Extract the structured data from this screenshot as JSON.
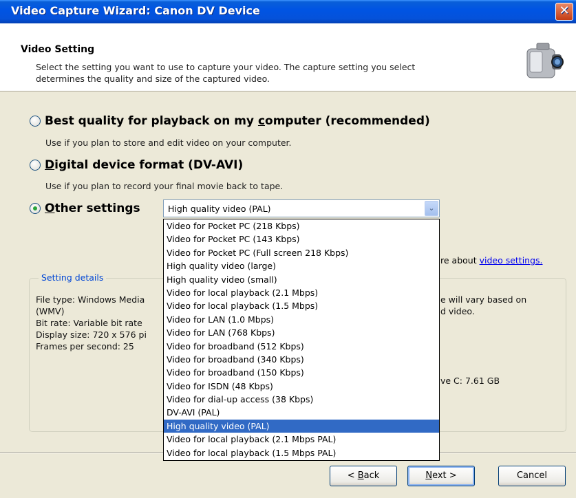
{
  "window": {
    "title": "Video Capture Wizard: Canon DV Device",
    "close_glyph": "✕"
  },
  "header": {
    "title": "Video Setting",
    "desc_line1": "Select the setting you want to use to capture your video. The capture setting you select",
    "desc_line2": "determines the quality and size of the captured video.",
    "icon": "camcorder-icon"
  },
  "options": [
    {
      "pre": "Best quality for playback on my ",
      "ul": "c",
      "post": "omputer (recommended)",
      "desc": "Use if you plan to store and edit video on your computer.",
      "checked": false
    },
    {
      "pre": "",
      "ul": "D",
      "post": "igital device format (DV-AVI)",
      "desc": "Use if you plan to record your final movie back to tape.",
      "checked": false
    },
    {
      "pre": "",
      "ul": "O",
      "post": "ther settings",
      "desc": "",
      "checked": true
    }
  ],
  "select": {
    "value": "High quality video (PAL)",
    "arrow_glyph": "⌄"
  },
  "dropdown": {
    "items": [
      "Video for Pocket PC (218 Kbps)",
      "Video for Pocket PC (143 Kbps)",
      "Video for Pocket PC (Full screen 218 Kbps)",
      "High quality video (large)",
      "High quality video (small)",
      "Video for local playback (2.1 Mbps)",
      "Video for local playback (1.5 Mbps)",
      "Video for LAN (1.0 Mbps)",
      "Video for LAN (768 Kbps)",
      "Video for broadband (512 Kbps)",
      "Video for broadband (340 Kbps)",
      "Video for broadband (150 Kbps)",
      "Video for ISDN (48 Kbps)",
      "Video for dial-up access (38 Kbps)",
      "DV-AVI (PAL)",
      "High quality video (PAL)",
      "Video for local playback (2.1 Mbps PAL)",
      "Video for local playback (1.5 Mbps PAL)"
    ],
    "selected_index": 15
  },
  "learn_more": {
    "prefix": "re about ",
    "link": "video settings."
  },
  "setting_details": {
    "label": "Setting details",
    "lines": [
      "File type: Windows Media",
      "(WMV)",
      "Bit rate: Variable bit rate",
      "Display size: 720 x 576 pi",
      "Frames per second: 25"
    ],
    "right_lines": [
      "e will vary based on",
      "d video."
    ],
    "drive_text": "ve C: 7.61 GB"
  },
  "buttons": {
    "back": {
      "pre": "< ",
      "ul": "B",
      "post": "ack"
    },
    "next": {
      "pre": "",
      "ul": "N",
      "post": "ext >"
    },
    "cancel": "Cancel"
  }
}
